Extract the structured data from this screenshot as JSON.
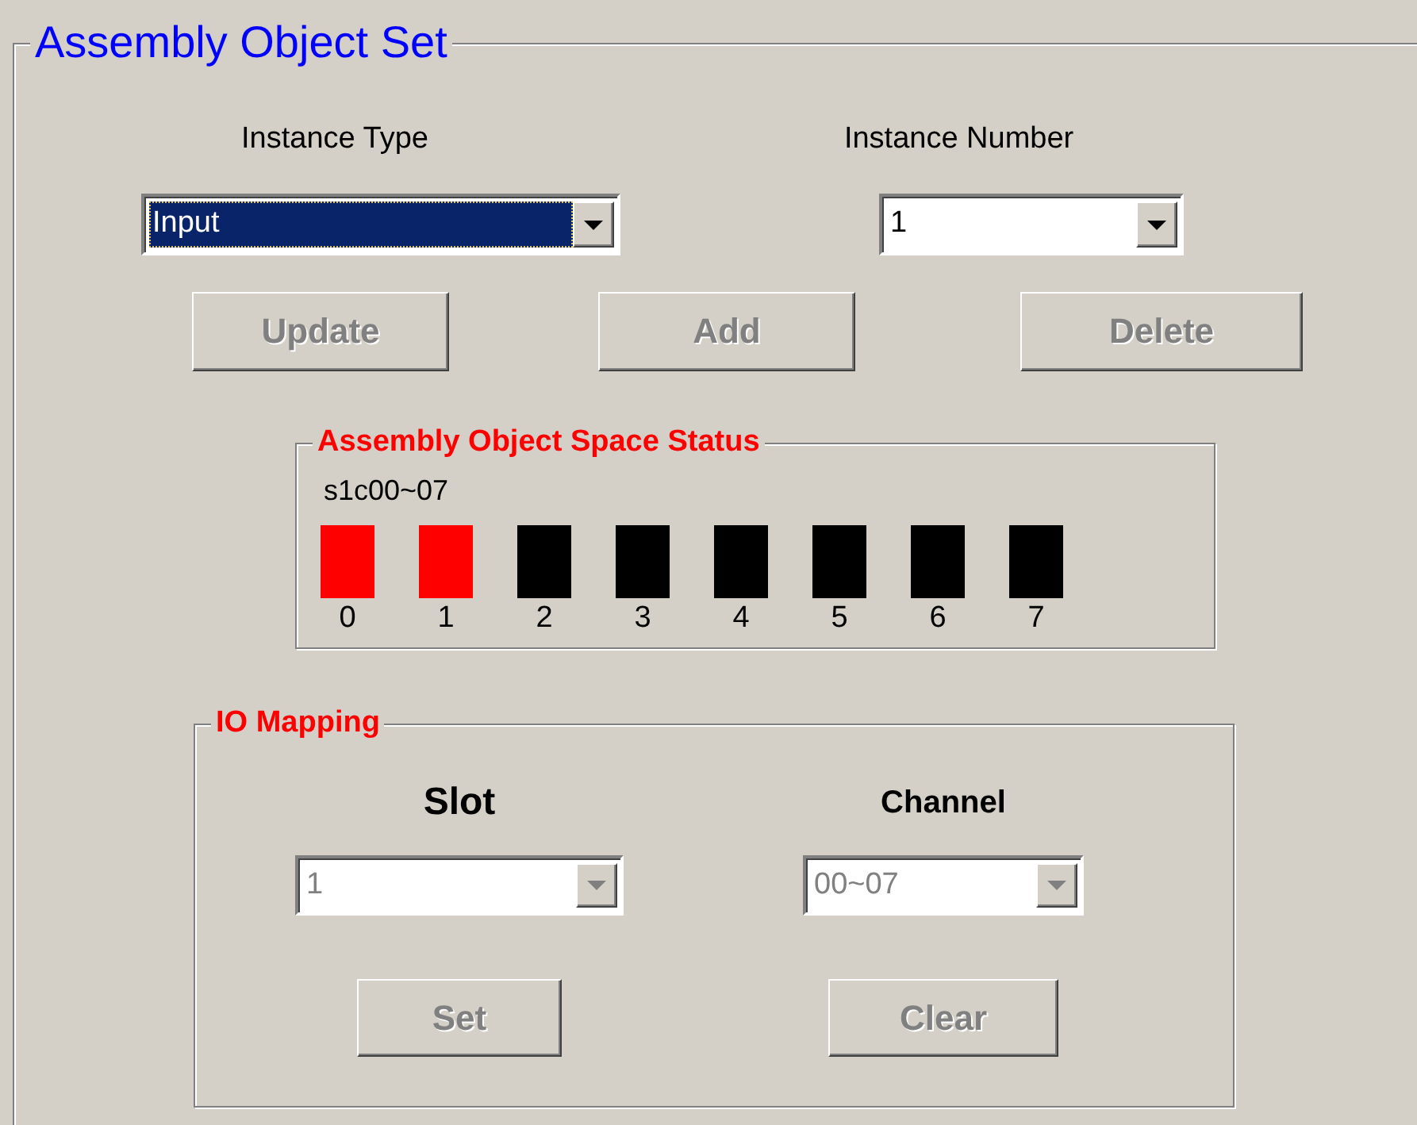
{
  "group": {
    "title": "Assembly Object Set"
  },
  "instance_type": {
    "label": "Instance Type",
    "value": "Input",
    "focused": true,
    "disabled": false
  },
  "instance_number": {
    "label": "Instance Number",
    "value": "1",
    "focused": false,
    "disabled": false
  },
  "buttons": [
    {
      "label": "Update",
      "disabled": true
    },
    {
      "label": "Add",
      "disabled": true
    },
    {
      "label": "Delete",
      "disabled": true
    }
  ],
  "space_status": {
    "title": "Assembly Object Space Status",
    "range": "s1c00~07",
    "blocks": [
      {
        "label": "0",
        "used": true
      },
      {
        "label": "1",
        "used": true
      },
      {
        "label": "2",
        "used": false
      },
      {
        "label": "3",
        "used": false
      },
      {
        "label": "4",
        "used": false
      },
      {
        "label": "5",
        "used": false
      },
      {
        "label": "6",
        "used": false
      },
      {
        "label": "7",
        "used": false
      }
    ]
  },
  "io_mapping": {
    "title": "IO Mapping",
    "slot": {
      "label": "Slot",
      "value": "1",
      "focused": false,
      "disabled": true
    },
    "channel": {
      "label": "Channel",
      "value": "00~07",
      "focused": false,
      "disabled": true
    },
    "buttons": [
      {
        "label": "Set",
        "disabled": true
      },
      {
        "label": "Clear",
        "disabled": true
      }
    ]
  }
}
